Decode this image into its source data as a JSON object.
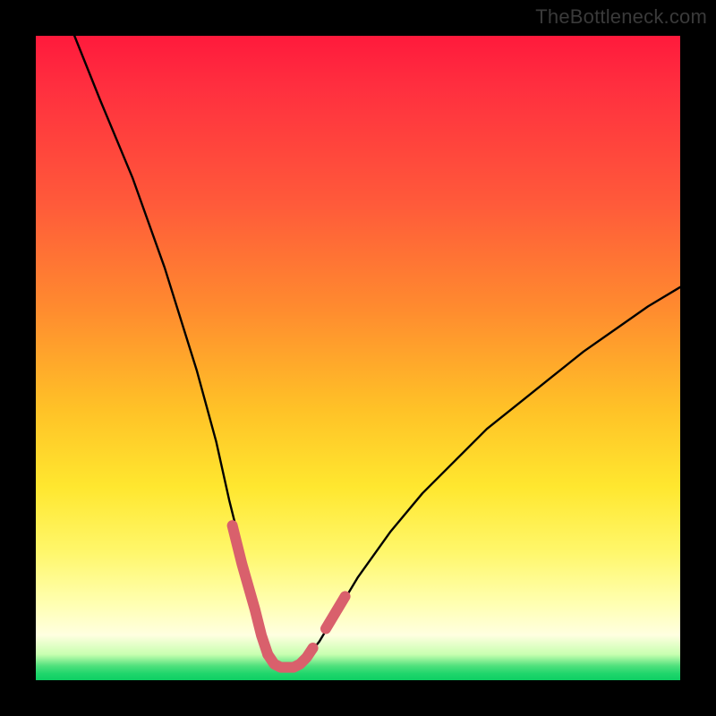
{
  "watermark": "TheBottleneck.com",
  "colors": {
    "background": "#000000",
    "curve": "#000000",
    "highlight": "#d9606c"
  },
  "chart_data": {
    "type": "line",
    "title": "",
    "xlabel": "",
    "ylabel": "",
    "xlim": [
      0,
      100
    ],
    "ylim": [
      0,
      100
    ],
    "grid": false,
    "legend": false,
    "annotations": [],
    "series": [
      {
        "name": "bottleneck-curve",
        "x": [
          6,
          10,
          15,
          20,
          25,
          28,
          30,
          32,
          34,
          35,
          36,
          37,
          38,
          39,
          40,
          41,
          42,
          44,
          47,
          50,
          55,
          60,
          65,
          70,
          75,
          80,
          85,
          90,
          95,
          100
        ],
        "y": [
          100,
          90,
          78,
          64,
          48,
          37,
          28,
          20,
          12,
          7,
          4,
          2.5,
          2,
          2,
          2,
          2.5,
          3.5,
          6,
          11,
          16,
          23,
          29,
          34,
          39,
          43,
          47,
          51,
          54.5,
          58,
          61
        ]
      }
    ],
    "highlight_segments": [
      {
        "x": [
          30.5,
          32,
          34,
          35,
          36
        ],
        "y": [
          24,
          18,
          11,
          7,
          4
        ]
      },
      {
        "x": [
          36,
          37,
          38,
          39,
          40,
          41,
          42,
          43
        ],
        "y": [
          4,
          2.5,
          2,
          2,
          2,
          2.5,
          3.5,
          5
        ]
      },
      {
        "x": [
          45,
          46.5,
          48
        ],
        "y": [
          8,
          10.5,
          13
        ]
      }
    ]
  }
}
